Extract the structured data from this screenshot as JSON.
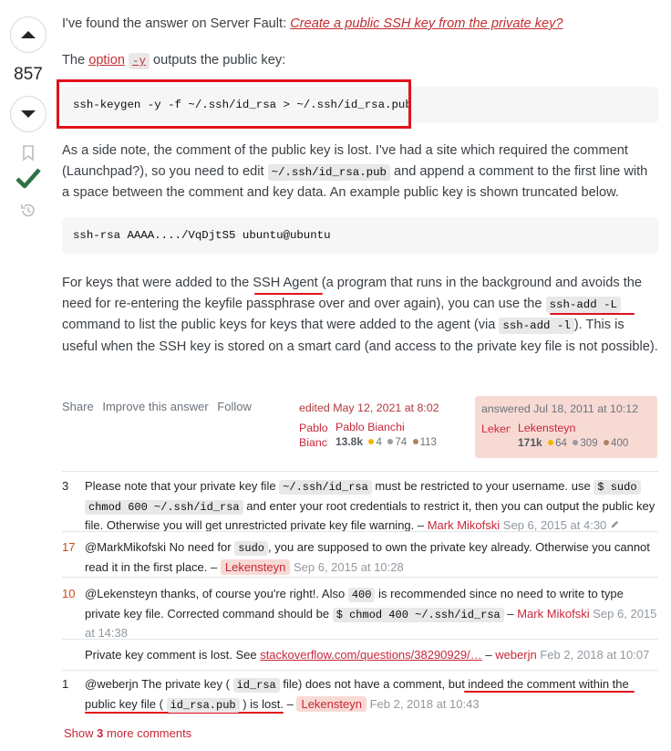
{
  "vote": {
    "score": "857"
  },
  "answer": {
    "intro_text": "I've found the answer on Server Fault: ",
    "intro_link": "Create a public SSH key from the private key?",
    "the": "The ",
    "option_link": "option",
    "option_code": "-y",
    "option_rest": " outputs the public key:",
    "code1": "ssh-keygen -y -f ~/.ssh/id_rsa > ~/.ssh/id_rsa.pub",
    "p2a": "As a side note, the comment of the public key is lost. I've had a site which required the comment (Launchpad?), so you need to edit ",
    "p2code": "~/.ssh/id_rsa.pub",
    "p2b": " and append a comment to the first line with a space between the comment and key data. An example public key is shown truncated below.",
    "code2": "ssh-rsa AAAA..../VqDjtS5 ubuntu@ubuntu",
    "p3a": "For keys that were added to the ",
    "p3link": "SSH Agent",
    "p3b": " (a program that runs in the background and avoids the need for re-entering the keyfile passphrase over and over again), you can use the ",
    "p3code1": "ssh-add -L",
    "p3c": " command to list the public keys for keys that were added to the agent (via ",
    "p3code2": "ssh-add -l",
    "p3d": "). This is useful when the SSH key is stored on a smart card (and access to the private key file is not possible)."
  },
  "menu": {
    "share": "Share",
    "improve": "Improve this answer",
    "follow": "Follow"
  },
  "editor": {
    "action": "edited May 12, 2021 at 8:02",
    "avatar_alt": "Pablo Bianchi",
    "name": "Pablo Bianchi",
    "rep": "13.8k",
    "gold": "4",
    "silver": "74",
    "bronze": "113"
  },
  "author": {
    "action": "answered Jul 18, 2011 at 10:12",
    "avatar_alt": "Lekensteyn",
    "name": "Lekensteyn",
    "rep": "171k",
    "gold": "64",
    "silver": "309",
    "bronze": "400"
  },
  "comments": [
    {
      "score": "3",
      "t1": "Please note that your private key file ",
      "c1": "~/.ssh/id_rsa",
      "t2": " must be restricted to your username. use ",
      "c2": "$ sudo",
      "c3": "chmod 600 ~/.ssh/id_rsa",
      "t3": " and enter your root credentials to restrict it, then you can output the public key file. Otherwise you will get unrestricted private key file warning. – ",
      "user": "Mark Mikofski",
      "date": "Sep 6, 2015 at 4:30"
    },
    {
      "score": "17",
      "t1": "@MarkMikofski No need for ",
      "c1": "sudo",
      "t2": ", you are supposed to own the private key already. Otherwise you cannot read it in the first place. – ",
      "user": "Lekensteyn",
      "date": "Sep 6, 2015 at 10:28"
    },
    {
      "score": "10",
      "t1": "@Lekensteyn thanks, of course you're right!. Also ",
      "c1": "400",
      "t2": " is recommended since no need to write to type private key file. Corrected command should be ",
      "c2": "$ chmod 400 ~/.ssh/id_rsa",
      "t3": " – ",
      "user": "Mark Mikofski",
      "date": "Sep 6, 2015 at 14:38"
    },
    {
      "score": "",
      "t1": "Private key comment is lost. See ",
      "link": "stackoverflow.com/questions/38290929/…",
      "t2": " – ",
      "user": "weberjn",
      "date": "Feb 2, 2018 at 10:07"
    },
    {
      "score": "1",
      "t1": "@weberjn The private key ( ",
      "c1": "id_rsa",
      "t2": " file) does not have a comment, but indeed the comment within the public key file ( ",
      "c2": "id_rsa.pub",
      "t3": " ) is lost. – ",
      "user": "Lekensteyn",
      "date": "Feb 2, 2018 at 10:43"
    }
  ],
  "show_more": {
    "prefix": "Show ",
    "count": "3",
    "suffix": " more comments"
  },
  "colors": {
    "accent": "#c7283a",
    "highlight_red": "#e0121c",
    "accepted_green": "#2f6f44",
    "op_bg": "#f8dad4"
  },
  "icons": [
    "chevron-up-icon",
    "chevron-down-icon",
    "bookmark-icon",
    "checkmark-icon",
    "history-icon",
    "pencil-icon"
  ]
}
